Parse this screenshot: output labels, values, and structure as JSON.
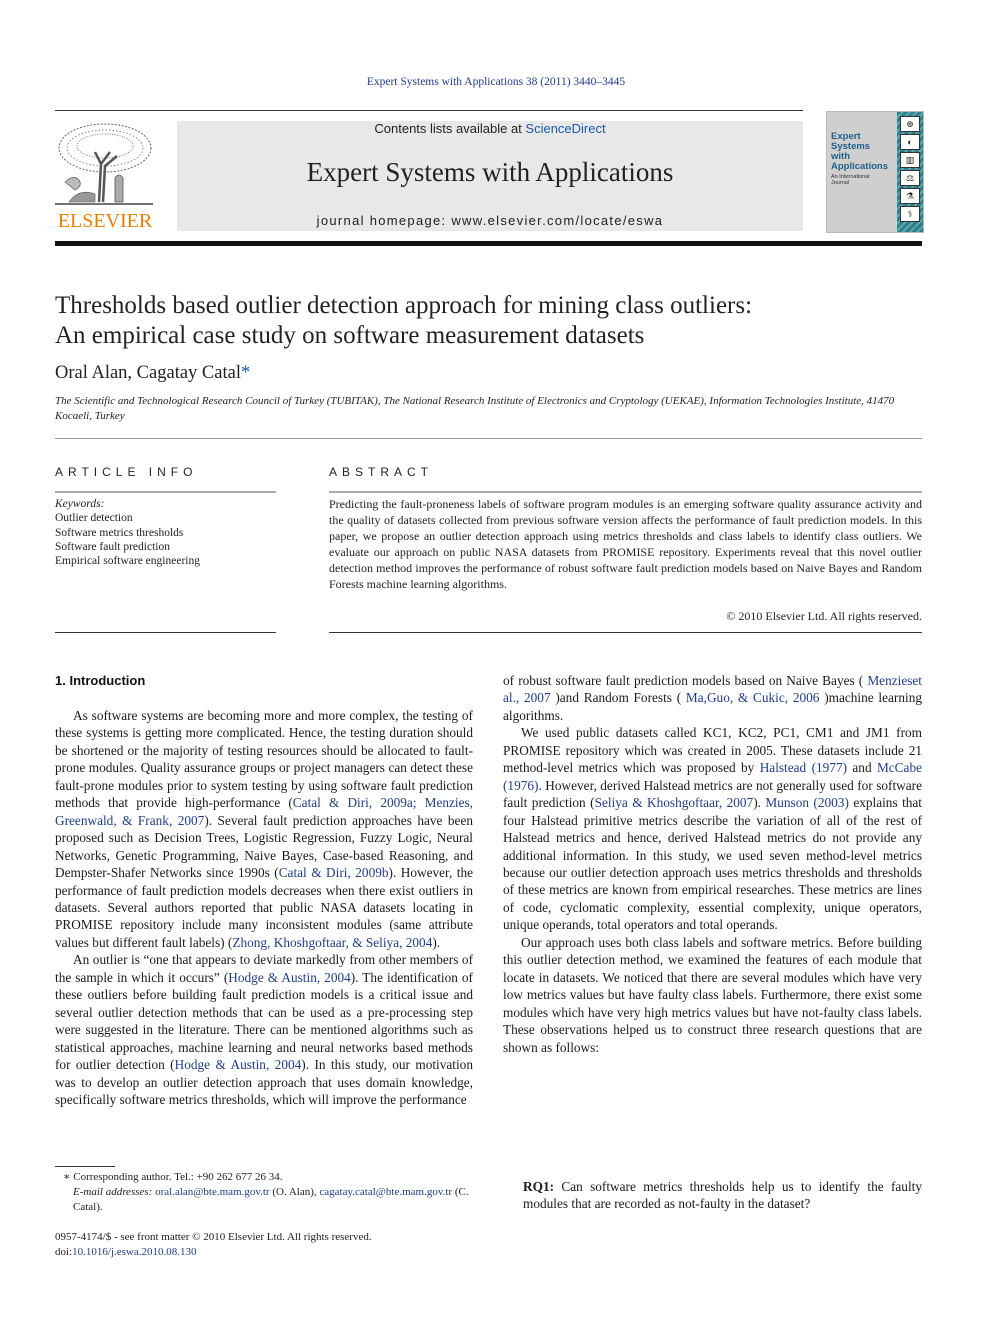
{
  "header": {
    "journal_reference": "Expert Systems with Applications 38 (2011) 3440–3445",
    "contents_prefix": "Contents lists available at ",
    "contents_link": "ScienceDirect",
    "journal_title": "Expert Systems with Applications",
    "homepage": "journal homepage: www.elsevier.com/locate/eswa",
    "publisher_logo_text": "ELSEVIER",
    "cover": {
      "title_line1": "Expert",
      "title_line2": "Systems",
      "title_line3": "with",
      "title_line4": "Applications",
      "subtitle_line1": "An International",
      "subtitle_line2": "Journal"
    },
    "colors": {
      "publisher_orange": "#f07d00",
      "link_blue": "#1f3b8f",
      "banner_gray": "#e8e8e8",
      "cover_teal": "#2e7f8a"
    }
  },
  "article": {
    "title_line1": "Thresholds based outlier detection approach for mining class outliers:",
    "title_line2": "An empirical case study on software measurement datasets",
    "authors": "Oral Alan, Cagatay Catal",
    "corresponding_marker": "*",
    "affiliation": "The Scientific and Technological Research Council of Turkey (TUBITAK), The National Research Institute of Electronics and Cryptology (UEKAE), Information Technologies Institute, 41470 Kocaeli, Turkey"
  },
  "article_info": {
    "heading": "ARTICLE INFO",
    "keywords_label": "Keywords:",
    "keywords": [
      "Outlier detection",
      "Software metrics thresholds",
      "Software fault prediction",
      "Empirical software engineering"
    ]
  },
  "abstract": {
    "heading": "ABSTRACT",
    "text": "Predicting the fault-proneness labels of software program modules is an emerging software quality assurance activity and the quality of datasets collected from previous software version affects the performance of fault prediction models. In this paper, we propose an outlier detection approach using metrics thresholds and class labels to identify class outliers. We evaluate our approach on public NASA datasets from PROMISE repository. Experiments reveal that this novel outlier detection method improves the performance of robust software fault prediction models based on Naive Bayes and Random Forests machine learning algorithms.",
    "copyright": "© 2010 Elsevier Ltd. All rights reserved."
  },
  "introduction": {
    "heading": "1. Introduction",
    "p1": {
      "t1": "As software systems are becoming more and more complex, the testing of these systems is getting more complicated. Hence, the testing duration should be shortened or the majority of testing resources should be allocated to fault-prone modules. Quality assurance groups or project managers can detect these fault-prone modules prior to system testing by using software fault prediction methods that provide high-performance (",
      "c1": "Catal & Diri, 2009a; Menzies, Greenwald, & Frank, 2007",
      "t2": "). Several fault prediction approaches have been proposed such as Decision Trees, Logistic Regression, Fuzzy Logic, Neural Networks, Genetic Programming, Naive Bayes, Case-based Reasoning, and Dempster-Shafer Networks since 1990s (",
      "c2": "Catal & Diri, 2009b",
      "t3": "). However, the performance of fault prediction models decreases when there exist outliers in datasets. Several authors reported that public NASA datasets locating in PROMISE repository include many inconsistent modules (same attribute values but different fault labels) (",
      "c3": "Zhong, Khoshgoftaar, & Seliya, 2004",
      "t4": ")."
    },
    "p2": {
      "t1": "An outlier is “one that appears to deviate markedly from other members of the sample in which it occurs” (",
      "c1": "Hodge & Austin, 2004",
      "t2": "). The identification of these outliers before building fault prediction models is a critical issue and several outlier detection methods that can be used as a pre-processing step were suggested in the literature. There can be mentioned algorithms such as statistical approaches, machine learning and neural networks based methods for outlier detection (",
      "c2": "Hodge & Austin, 2004",
      "t3": "). In this study, our motivation was to develop an outlier detection approach that uses domain knowledge, specifically software metrics thresholds, which will improve the performance of robust software fault prediction models based on Naive Bayes (",
      "c3": "Menzies et al., 2007",
      "t4": ") and Random Forests (",
      "c4": "Ma, Guo, & Cukic, 2006",
      "t5": ") machine learning algorithms."
    },
    "p3": {
      "t1": "We used public datasets called KC1, KC2, PC1, CM1 and JM1 from PROMISE repository which was created in 2005. These datasets include 21 method-level metrics which was proposed by ",
      "c1": "Halstead (1977)",
      "t2": " and ",
      "c2": "McCabe (1976)",
      "t3": ". However, derived Halstead metrics are not generally used for software fault prediction (",
      "c3": "Seliya & Khoshgoftaar, 2007",
      "t4": "). ",
      "c4": "Munson (2003)",
      "t5": " explains that four Halstead primitive metrics describe the variation of all of the rest of Halstead metrics and hence, derived Halstead metrics do not provide any additional information. In this study, we used seven method-level metrics because our outlier detection approach uses metrics thresholds and thresholds of these metrics are known from empirical researches. These metrics are lines of code, cyclomatic complexity, essential complexity, unique operators, unique operands, total operators and total operands."
    },
    "p4": "Our approach uses both class labels and software metrics. Before building this outlier detection method, we examined the features of each module that locate in datasets. We noticed that there are several modules which have very low metrics values but have faulty class labels. Furthermore, there exist some modules which have very high metrics values but have not-faulty class labels. These observations helped us to construct three research questions that are shown as follows:",
    "rq1_label": "RQ1:",
    "rq1_text": " Can software metrics thresholds help us to identify the faulty modules that are recorded as not-faulty in the dataset?"
  },
  "footnotes": {
    "corresponding": "∗ Corresponding author. Tel.: +90 262 677 26 34.",
    "email_label": "E-mail addresses:",
    "email1": "oral.alan@bte.mam.gov.tr",
    "email1_owner": " (O. Alan), ",
    "email2": "cagatay.catal@bte.mam.gov.tr",
    "email2_owner": " (C. Catal).",
    "issn_line": "0957-4174/$ - see front matter © 2010 Elsevier Ltd. All rights reserved.",
    "doi_label": "doi:",
    "doi": "10.1016/j.eswa.2010.08.130"
  }
}
